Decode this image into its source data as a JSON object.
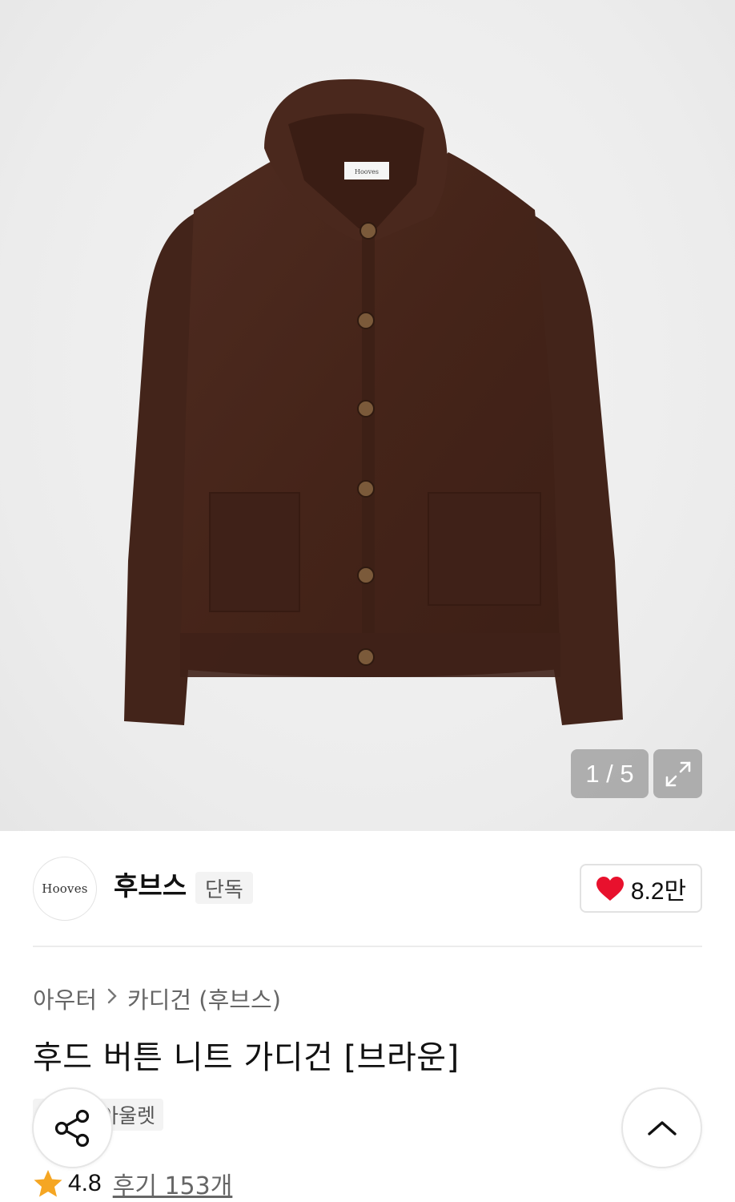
{
  "gallery": {
    "current": "1 / 5",
    "product_label": "Hooves",
    "fullscreen_icon": "expand-icon"
  },
  "brand": {
    "logo_text": "Hooves",
    "name": "후브스",
    "badge": "단독"
  },
  "like": {
    "icon": "heart-icon",
    "count": "8.2만",
    "color": "#e8112d"
  },
  "breadcrumb": {
    "category": "아우터",
    "separator_icon": "chevron-right-icon",
    "subcategory": "카디건 (후브스)"
  },
  "product": {
    "title": "후드 버튼 니트 가디건 [브라운]",
    "tags": [
      "단독",
      "아울렛"
    ]
  },
  "rating": {
    "icon": "star-icon",
    "color": "#f5a623",
    "score": "4.8",
    "review_link": "후기 153개"
  },
  "floating": {
    "share_icon": "share-icon",
    "scroll_top_icon": "chevron-up-icon"
  }
}
